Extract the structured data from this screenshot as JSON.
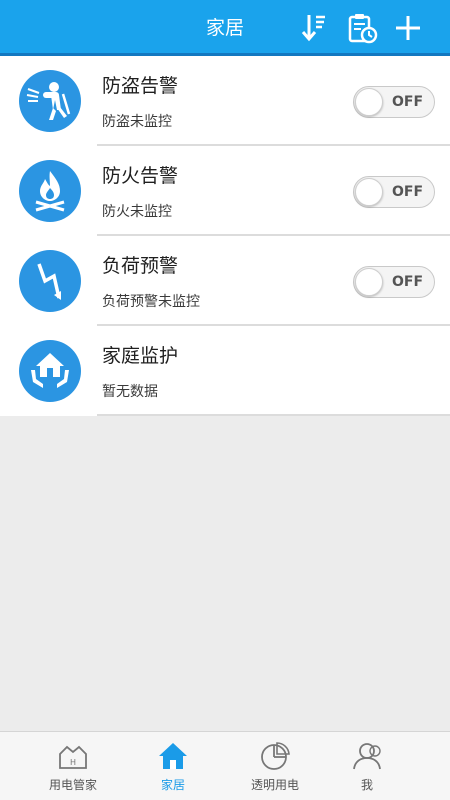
{
  "header": {
    "title": "家居",
    "icons": [
      "sort-down-icon",
      "schedule-clipboard-icon",
      "add-icon"
    ]
  },
  "items": [
    {
      "title": "防盗告警",
      "subtitle": "防盗未监控",
      "icon": "intruder-icon",
      "toggle": "OFF"
    },
    {
      "title": "防火告警",
      "subtitle": "防火未监控",
      "icon": "fire-icon",
      "toggle": "OFF"
    },
    {
      "title": "负荷预警",
      "subtitle": "负荷预警未监控",
      "icon": "lightning-icon",
      "toggle": "OFF"
    },
    {
      "title": "家庭监护",
      "subtitle": "暂无数据",
      "icon": "home-care-icon"
    }
  ],
  "tabs": [
    {
      "label": "用电管家",
      "icon": "house-h-icon",
      "active": false
    },
    {
      "label": "家居",
      "icon": "home-icon",
      "active": true
    },
    {
      "label": "透明用电",
      "icon": "pie-chart-icon",
      "active": false
    },
    {
      "label": "我",
      "icon": "user-icon",
      "active": false
    }
  ],
  "colors": {
    "header": "#1aa3ec",
    "accent": "#2b95e2",
    "active_tab": "#1a9be8",
    "background": "#ececec"
  }
}
